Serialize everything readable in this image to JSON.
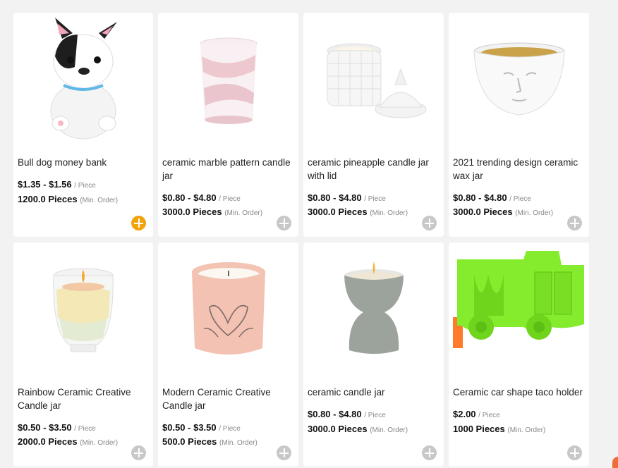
{
  "products": [
    {
      "title": "Bull dog money bank",
      "price": "$1.35 - $1.56",
      "unit": "/ Piece",
      "qty": "1200.0 Pieces",
      "moq": "(Min. Order)",
      "add_icon": "plus-circle-icon",
      "add_active": true
    },
    {
      "title": "ceramic marble pattern candle jar",
      "price": "$0.80 - $4.80",
      "unit": "/ Piece",
      "qty": "3000.0 Pieces",
      "moq": "(Min. Order)",
      "add_icon": "plus-circle-icon",
      "add_active": false
    },
    {
      "title": "ceramic pineapple candle jar with lid",
      "price": "$0.80 - $4.80",
      "unit": "/ Piece",
      "qty": "3000.0 Pieces",
      "moq": "(Min. Order)",
      "add_icon": "plus-circle-icon",
      "add_active": false
    },
    {
      "title": "2021 trending design ceramic wax jar",
      "price": "$0.80 - $4.80",
      "unit": "/ Piece",
      "qty": "3000.0 Pieces",
      "moq": "(Min. Order)",
      "add_icon": "plus-circle-icon",
      "add_active": false
    },
    {
      "title": "Rainbow Ceramic Creative Candle jar",
      "price": "$0.50 - $3.50",
      "unit": "/ Piece",
      "qty": "2000.0 Pieces",
      "moq": "(Min. Order)",
      "add_icon": "plus-circle-icon",
      "add_active": false
    },
    {
      "title": "Modern Ceramic Creative Candle jar",
      "price": "$0.50 - $3.50",
      "unit": "/ Piece",
      "qty": "500.0 Pieces",
      "moq": "(Min. Order)",
      "add_icon": "plus-circle-icon",
      "add_active": false
    },
    {
      "title": "ceramic candle jar",
      "price": "$0.80 - $4.80",
      "unit": "/ Piece",
      "qty": "3000.0 Pieces",
      "moq": "(Min. Order)",
      "add_icon": "plus-circle-icon",
      "add_active": false
    },
    {
      "title": "Ceramic car shape taco holder",
      "price": "$2.00",
      "unit": "/ Piece",
      "qty": "1000 Pieces",
      "moq": "(Min. Order)",
      "add_icon": "plus-circle-icon",
      "add_active": false
    }
  ],
  "colors": {
    "add_active": "#f0a30a",
    "add_inactive": "#c8c8c8",
    "background": "#f2f2f2"
  }
}
